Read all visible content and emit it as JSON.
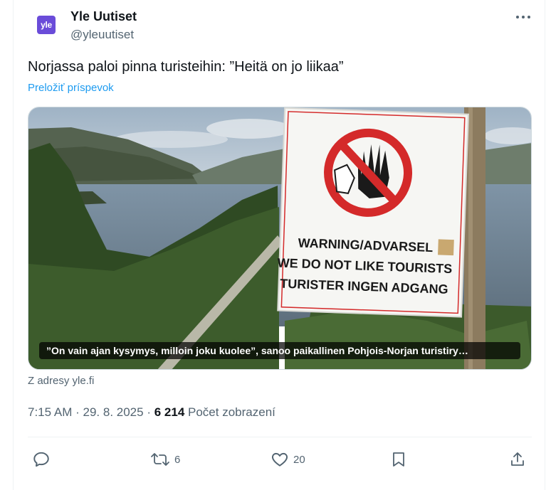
{
  "author": {
    "avatar_text": "yle",
    "name": "Yle Uutiset",
    "handle": "@yleuutiset"
  },
  "tweet": {
    "text": "Norjassa paloi pinna turisteihin: ”Heitä on jo liikaa”",
    "translate_label": "Preložiť príspevok"
  },
  "media": {
    "sign_line1": "WARNING/ADVARSEL",
    "sign_line2": "WE DO NOT LIKE TOURISTS",
    "sign_line3": "TURISTER INGEN ADGANG",
    "caption": "”On vain ajan kysymys, milloin joku kuolee”, sanoo paikallinen Pohjois-Norjan turistiry…",
    "source": "Z adresy yle.fi"
  },
  "meta": {
    "time": "7:15 AM",
    "separator": "·",
    "date": "29. 8. 2025",
    "views_count": "6 214",
    "views_label": "Počet zobrazení"
  },
  "actions": {
    "reposts": "6",
    "likes": "20"
  },
  "colors": {
    "accent": "#1d9bf0",
    "muted": "#536471",
    "avatar_bg": "#6a4cd9",
    "sign_red": "#d42a2a"
  }
}
